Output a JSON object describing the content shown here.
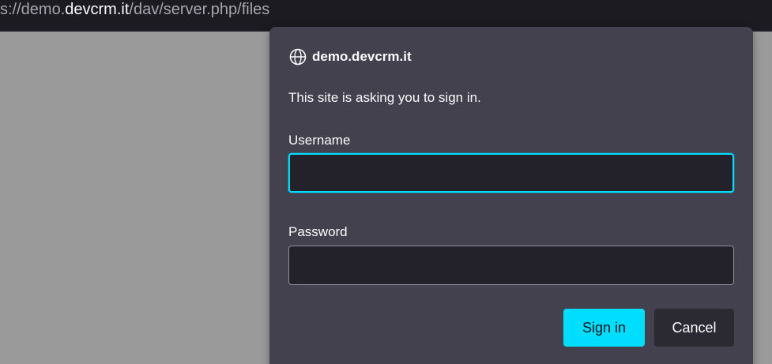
{
  "browser": {
    "url_prefix": "s://demo.",
    "url_host": "devcrm.it",
    "url_path": "/dav/server.php/files"
  },
  "dialog": {
    "origin": "demo.devcrm.it",
    "message": "This site is asking you to sign in.",
    "username_label": "Username",
    "username_value": "",
    "password_label": "Password",
    "password_value": "",
    "signin_label": "Sign in",
    "cancel_label": "Cancel"
  },
  "colors": {
    "accent": "#00ddff",
    "dialog_bg": "#42414d",
    "input_bg": "#23222b",
    "page_bg": "#9a9a9a"
  },
  "icons": {
    "origin_icon": "globe-icon"
  }
}
